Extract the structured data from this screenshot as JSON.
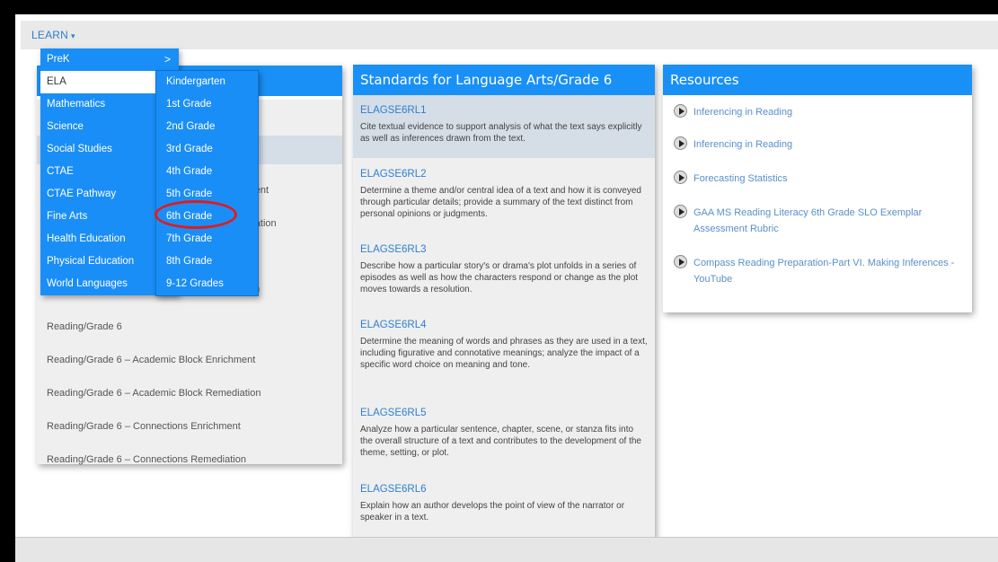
{
  "topbar": {
    "learn_label": "LEARN",
    "chevron": "▾"
  },
  "menu_primary": {
    "items": [
      {
        "label": "PreK"
      },
      {
        "label": "ELA"
      },
      {
        "label": "Mathematics"
      },
      {
        "label": "Science"
      },
      {
        "label": "Social Studies"
      },
      {
        "label": "CTAE"
      },
      {
        "label": "CTAE Pathway"
      },
      {
        "label": "Fine Arts"
      },
      {
        "label": "Health Education"
      },
      {
        "label": "Physical Education"
      },
      {
        "label": "World Languages"
      }
    ],
    "active": "ELA",
    "arrow": ">"
  },
  "menu_grades": {
    "items": [
      {
        "label": "Kindergarten"
      },
      {
        "label": "1st Grade"
      },
      {
        "label": "2nd Grade"
      },
      {
        "label": "3rd Grade"
      },
      {
        "label": "4th Grade"
      },
      {
        "label": "5th Grade"
      },
      {
        "label": "6th Grade"
      },
      {
        "label": "7th Grade"
      },
      {
        "label": "8th Grade"
      },
      {
        "label": "9-12 Grades"
      }
    ],
    "highlighted": "6th Grade"
  },
  "left_panel": {
    "partial_items": [
      {
        "label": "chment"
      },
      {
        "label": "nediation"
      },
      {
        "label": "nent"
      },
      {
        "label": "iation"
      }
    ],
    "items": [
      {
        "label": "Reading/Grade 6"
      },
      {
        "label": "Reading/Grade 6 – Academic Block Enrichment"
      },
      {
        "label": "Reading/Grade 6 – Academic Block Remediation"
      },
      {
        "label": "Reading/Grade 6 – Connections Enrichment"
      },
      {
        "label": "Reading/Grade 6 – Connections Remediation"
      }
    ]
  },
  "standards_panel": {
    "title": "Standards for Language Arts/Grade 6",
    "standards": [
      {
        "code": "ELAGSE6RL1",
        "text": "Cite textual evidence to support analysis of what the text says explicitly as well as inferences drawn from the text."
      },
      {
        "code": "ELAGSE6RL2",
        "text": "Determine a theme and/or central idea of a text and how it is conveyed through particular details; provide a summary of the text distinct from personal opinions or judgments."
      },
      {
        "code": "ELAGSE6RL3",
        "text": "Describe how a particular story's or drama's plot unfolds in a series of episodes as well as how the characters respond or change as the plot moves towards a resolution."
      },
      {
        "code": "ELAGSE6RL4",
        "text": "Determine the meaning of words and phrases as they are used in a text, including figurative and connotative meanings; analyze the impact of a specific word choice on meaning and tone."
      },
      {
        "code": "ELAGSE6RL5",
        "text": "Analyze how a particular sentence, chapter, scene, or stanza fits into the overall structure of a text and contributes to the development of the theme, setting, or plot."
      },
      {
        "code": "ELAGSE6RL6",
        "text": "Explain how an author develops the point of view of the narrator or speaker in a text."
      }
    ]
  },
  "resources_panel": {
    "title": "Resources",
    "items": [
      {
        "label": "Inferencing in Reading",
        "icon": "play-icon"
      },
      {
        "label": "Inferencing in Reading",
        "icon": "play-icon"
      },
      {
        "label": "Forecasting Statistics",
        "icon": "play-icon"
      },
      {
        "label": "GAA MS Reading Literacy 6th Grade SLO Exemplar Assessment Rubric",
        "icon": "play-icon"
      },
      {
        "label": "Compass Reading Preparation-Part VI. Making Inferences - YouTube",
        "icon": "play-icon"
      }
    ]
  },
  "colors": {
    "accent": "#1a8ef7",
    "link": "#2d7fd0",
    "highlight_ring": "#e21b1b"
  }
}
